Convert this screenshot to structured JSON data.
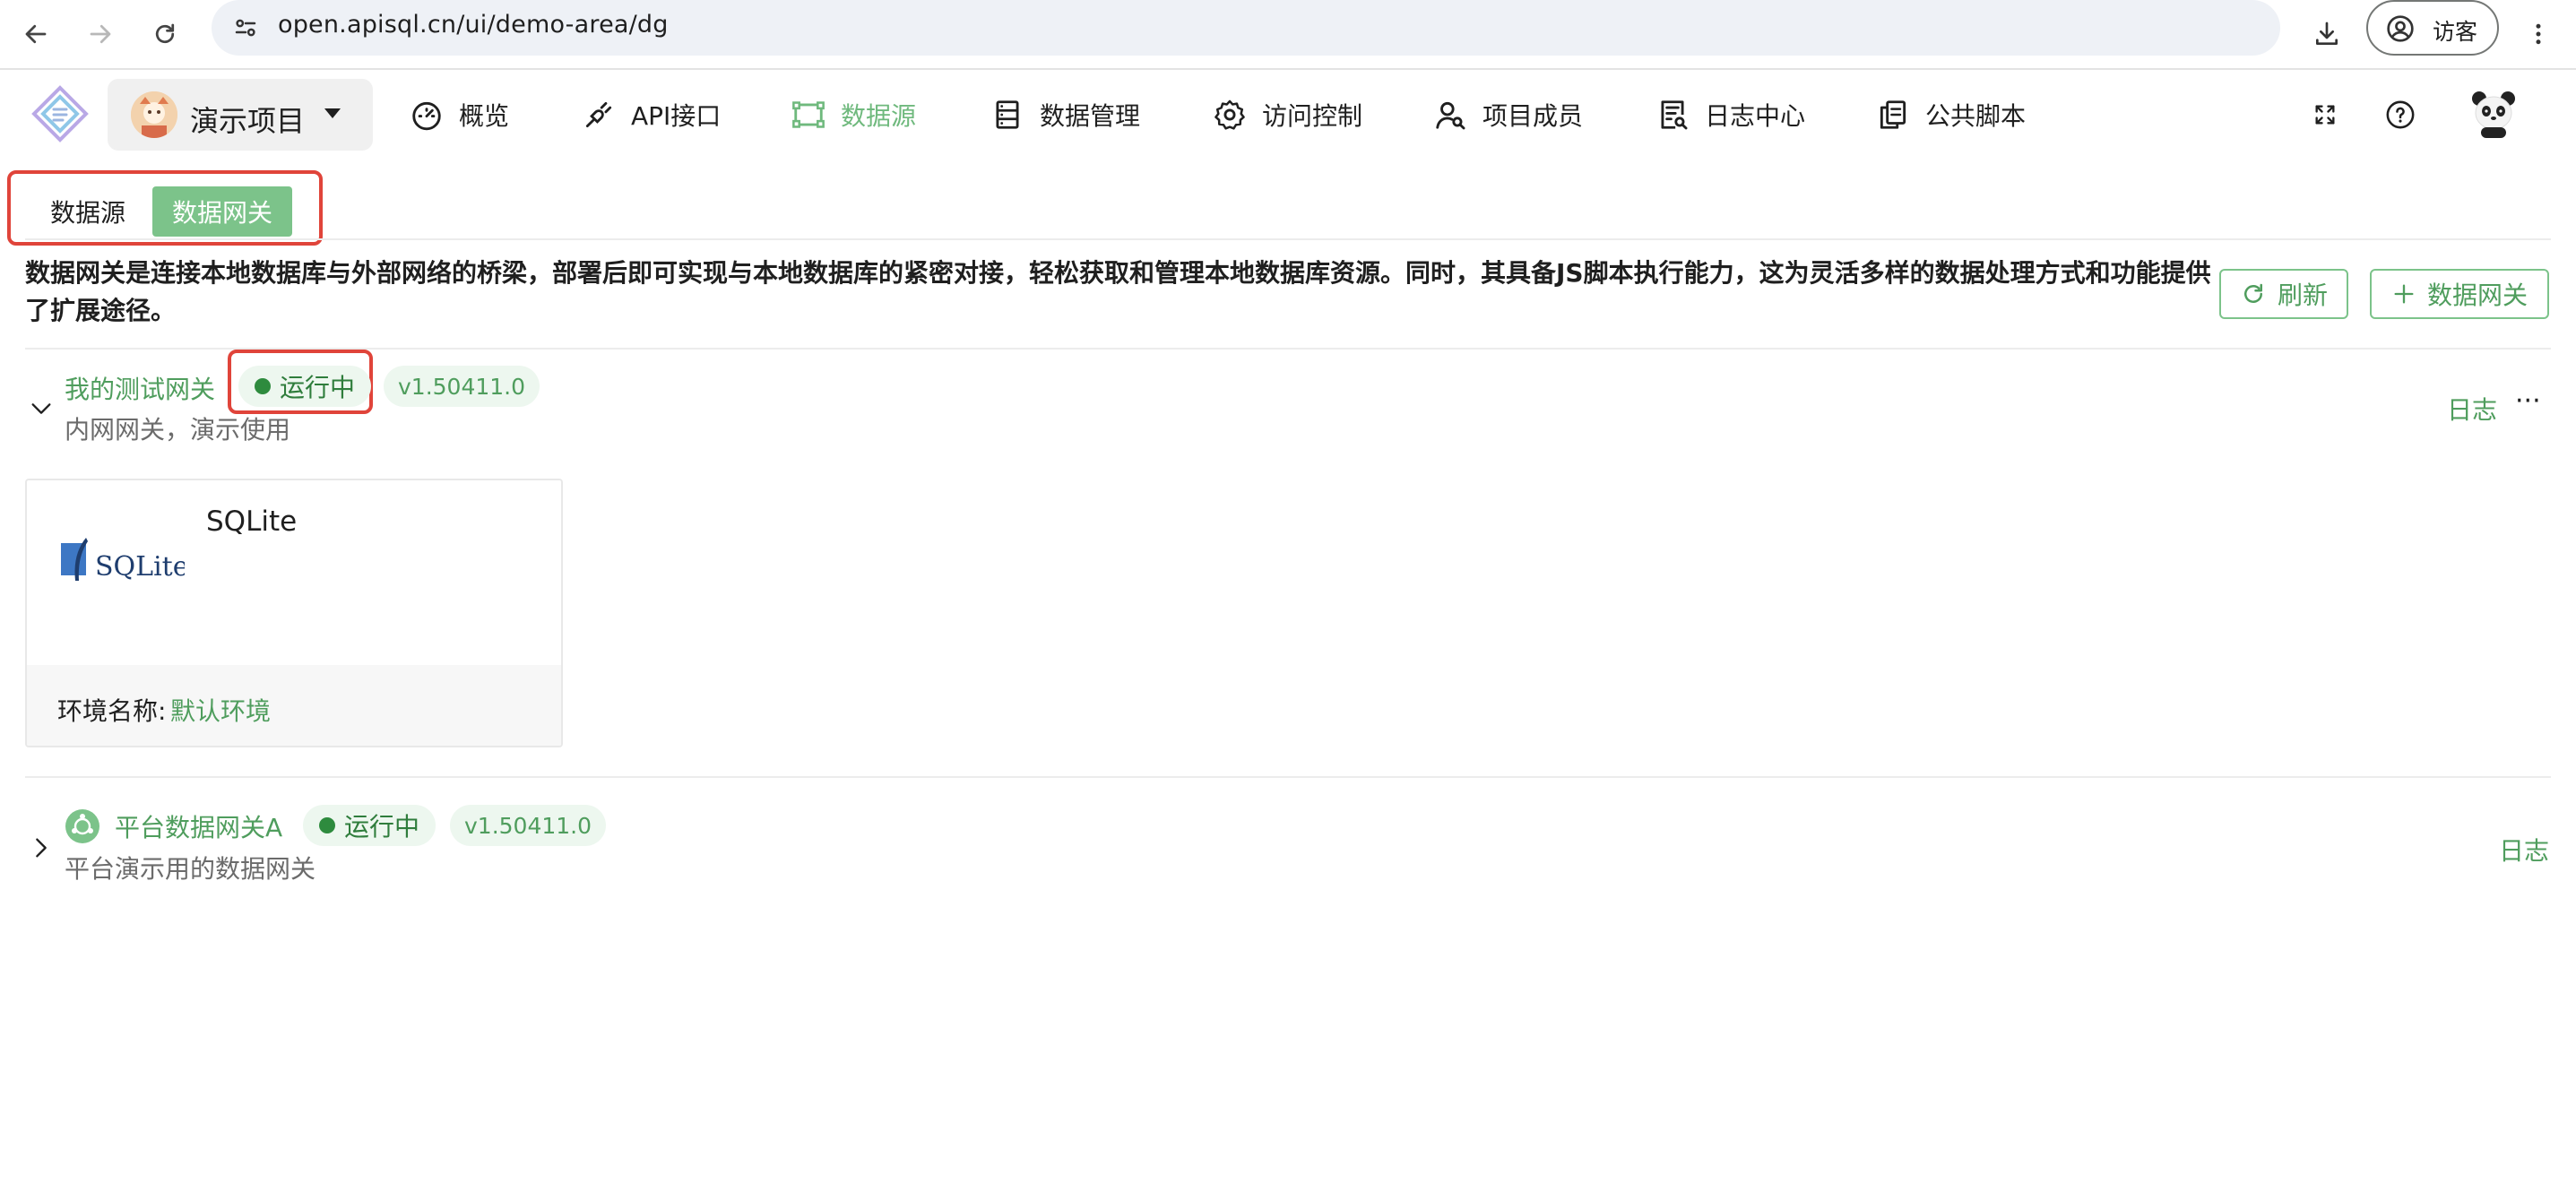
{
  "browser": {
    "url": "open.apisql.cn/ui/demo-area/dg",
    "profile_label": "访客"
  },
  "header": {
    "project_name": "演示项目",
    "menu": [
      {
        "label": "概览",
        "icon": "dashboard-icon"
      },
      {
        "label": "API接口",
        "icon": "plug-icon"
      },
      {
        "label": "数据源",
        "icon": "datasource-icon",
        "active": true
      },
      {
        "label": "数据管理",
        "icon": "database-icon"
      },
      {
        "label": "访问控制",
        "icon": "gear-icon"
      },
      {
        "label": "项目成员",
        "icon": "member-icon"
      },
      {
        "label": "日志中心",
        "icon": "log-icon"
      },
      {
        "label": "公共脚本",
        "icon": "script-icon"
      }
    ]
  },
  "tabs": [
    {
      "label": "数据源"
    },
    {
      "label": "数据网关",
      "active": true
    }
  ],
  "description": "数据网关是连接本地数据库与外部网络的桥梁，部署后即可实现与本地数据库的紧密对接，轻松获取和管理本地数据库资源。同时，其具备JS脚本执行能力，这为灵活多样的数据处理方式和功能提供了扩展途径。",
  "actions": {
    "refresh_label": "刷新",
    "add_gateway_label": "数据网关"
  },
  "gateways": [
    {
      "name": "我的测试网关",
      "status": "运行中",
      "version": "v1.50411.0",
      "description": "内网网关，演示使用",
      "log_label": "日志",
      "more_label": "···",
      "expanded": true,
      "datasources": [
        {
          "name": "SQLite",
          "logo_text": "SQLite",
          "env_label": "环境名称:",
          "env_value": "默认环境"
        }
      ]
    },
    {
      "name": "平台数据网关A",
      "status": "运行中",
      "version": "v1.50411.0",
      "description": "平台演示用的数据网关",
      "log_label": "日志",
      "expanded": false
    }
  ],
  "colors": {
    "accent": "#6fb97d",
    "accent_text": "#4f9d5d",
    "highlight_box": "#e0443a",
    "status_dot": "#2e8b3e"
  }
}
